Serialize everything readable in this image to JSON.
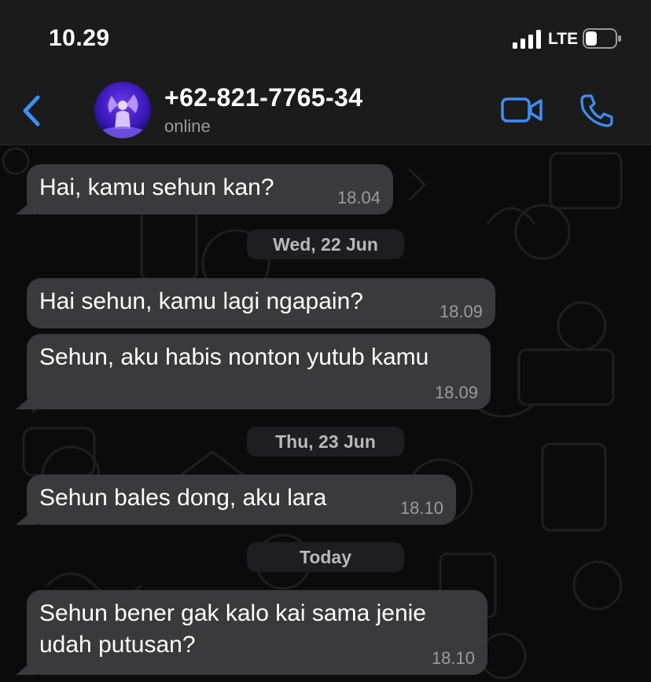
{
  "status_bar": {
    "time": "10.29",
    "carrier": "LTE"
  },
  "header": {
    "back_icon": "chevron-left-icon",
    "contact_name": "+62-821-7765-34",
    "contact_status": "online",
    "video_icon": "video-camera-icon",
    "call_icon": "phone-icon"
  },
  "messages": [
    {
      "text": "Hai, kamu sehun kan?",
      "time": "18.04"
    },
    {
      "text": "Hai sehun, kamu lagi ngapain?",
      "time": "18.09"
    },
    {
      "text": "Sehun, aku habis nonton yutub kamu",
      "time": "18.09"
    },
    {
      "text": "Sehun bales dong, aku lara",
      "time": "18.10"
    },
    {
      "text_line1": "Sehun bener gak kalo kai sama jenie",
      "text_line2": "udah putusan?",
      "time": "18.10"
    }
  ],
  "date_separators": [
    "Wed, 22 Jun",
    "Thu, 23 Jun",
    "Today"
  ],
  "colors": {
    "accent": "#3d8ef5",
    "bubble_incoming": "#3a3a3c",
    "header_bg": "#1b1b1b",
    "chat_bg": "#0b0b0b"
  }
}
